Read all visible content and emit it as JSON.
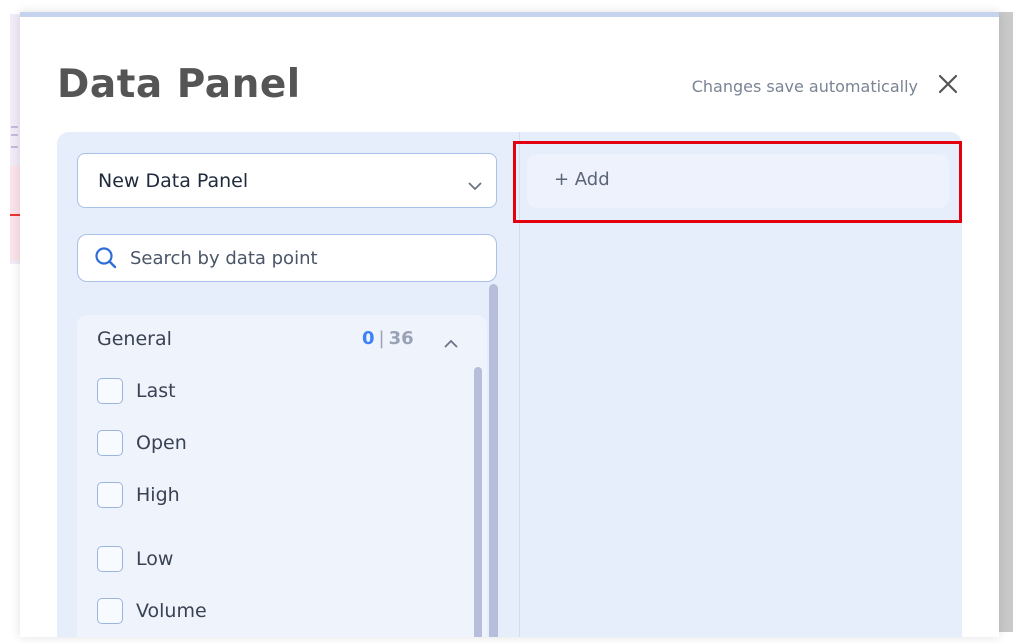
{
  "modal": {
    "title": "Data Panel",
    "autosave_note": "Changes save automatically",
    "close_icon": "close-icon"
  },
  "panel_select": {
    "value": "New Data Panel",
    "icon": "chevron-down-icon"
  },
  "search": {
    "placeholder": "Search by data point",
    "value": "",
    "icon": "search-icon"
  },
  "group": {
    "title": "General",
    "selected_count": "0",
    "separator": "|",
    "total_count": "36",
    "expanded": true,
    "icon": "chevron-up-icon",
    "items": [
      {
        "label": "Last",
        "checked": false
      },
      {
        "label": "Open",
        "checked": false
      },
      {
        "label": "High",
        "checked": false
      },
      {
        "label": "Low",
        "checked": false
      },
      {
        "label": "Volume",
        "checked": false
      }
    ]
  },
  "right_panel": {
    "add_label": "+ Add"
  },
  "colors": {
    "accent": "#3b82f6",
    "panel_bg": "#e6eefb",
    "highlight": "#e3000f"
  }
}
